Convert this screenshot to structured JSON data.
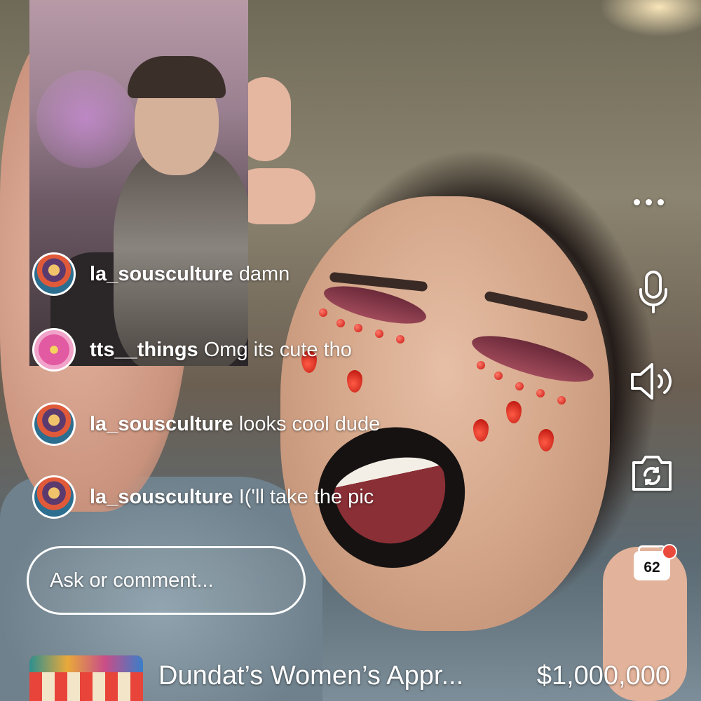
{
  "comments": [
    {
      "user": "la_sousculture",
      "text": "damn",
      "avatar": "colorful-portrait-avatar"
    },
    {
      "user": "tts__things",
      "text": "Omg its cute tho",
      "avatar": "pink-flower-avatar"
    },
    {
      "user": "la_sousculture",
      "text": "looks cool dude",
      "avatar": "colorful-portrait-avatar"
    },
    {
      "user": "la_sousculture",
      "text": "I('ll take the pic",
      "avatar": "colorful-portrait-avatar"
    }
  ],
  "comment_box": {
    "placeholder": "Ask or comment..."
  },
  "rail": {
    "icons": [
      "more-icon",
      "microphone-icon",
      "speaker-icon",
      "camera-flip-icon",
      "shopping-bag-icon"
    ],
    "bag_count": "62"
  },
  "product": {
    "name": "Dundat’s Women’s Appr...",
    "price": "$1,000,000"
  },
  "colors": {
    "badge_red": "#ea4a3c",
    "text": "#ffffff"
  }
}
